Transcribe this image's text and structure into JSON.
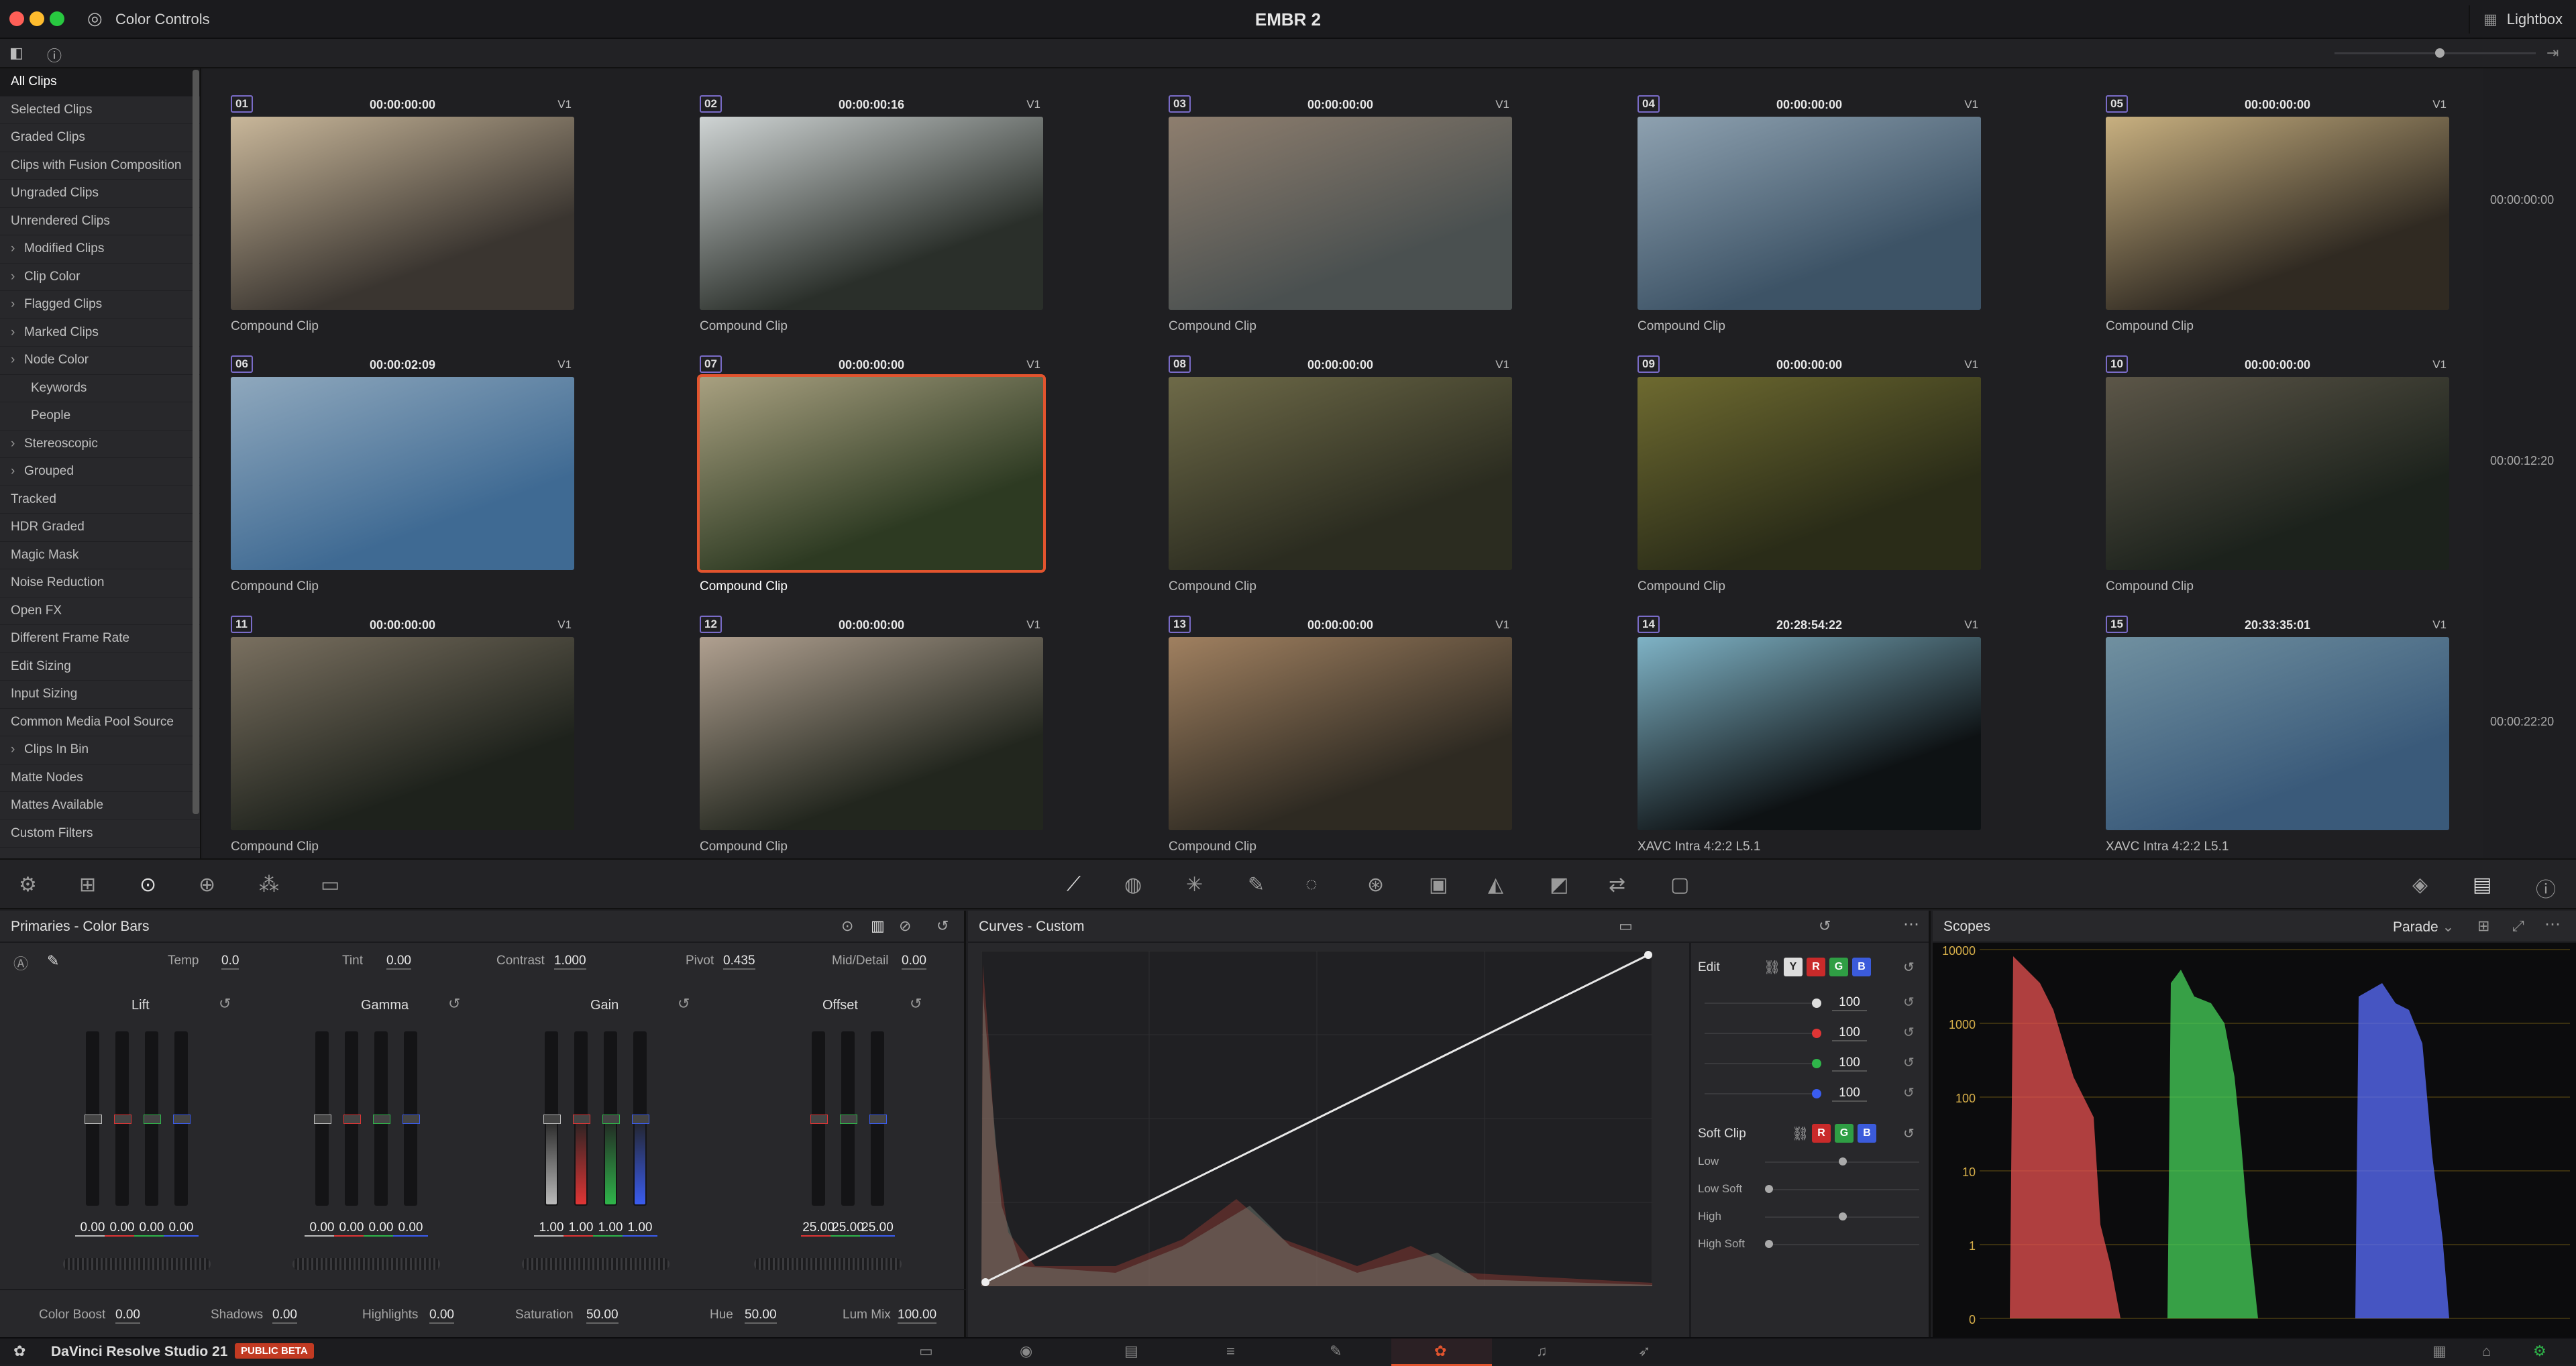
{
  "window": {
    "title": "EMBR 2",
    "panel_title": "Color Controls",
    "lightbox_label": "Lightbox"
  },
  "sidebar": {
    "items": [
      {
        "label": "All Clips",
        "selected": true,
        "expandable": false
      },
      {
        "label": "Selected Clips",
        "expandable": false
      },
      {
        "label": "Graded Clips",
        "expandable": false
      },
      {
        "label": "Clips with Fusion Composition",
        "expandable": false
      },
      {
        "label": "Ungraded Clips",
        "expandable": false
      },
      {
        "label": "Unrendered Clips",
        "expandable": false
      },
      {
        "label": "Modified Clips",
        "expandable": true
      },
      {
        "label": "Clip Color",
        "expandable": true
      },
      {
        "label": "Flagged Clips",
        "expandable": true
      },
      {
        "label": "Marked Clips",
        "expandable": true
      },
      {
        "label": "Node Color",
        "expandable": true
      },
      {
        "label": "Keywords",
        "child": true
      },
      {
        "label": "People",
        "child": true
      },
      {
        "label": "Stereoscopic",
        "expandable": true
      },
      {
        "label": "Grouped",
        "expandable": true
      },
      {
        "label": "Tracked",
        "expandable": false
      },
      {
        "label": "HDR Graded",
        "expandable": false
      },
      {
        "label": "Magic Mask",
        "expandable": false
      },
      {
        "label": "Noise Reduction",
        "expandable": false
      },
      {
        "label": "Open FX",
        "expandable": false
      },
      {
        "label": "Different Frame Rate",
        "expandable": false
      },
      {
        "label": "Edit Sizing",
        "expandable": false
      },
      {
        "label": "Input Sizing",
        "expandable": false
      },
      {
        "label": "Common Media Pool Source",
        "expandable": false
      },
      {
        "label": "Clips In Bin",
        "expandable": true
      },
      {
        "label": "Matte Nodes",
        "expandable": false
      },
      {
        "label": "Mattes Available",
        "expandable": false
      },
      {
        "label": "Custom Filters",
        "expandable": false
      }
    ]
  },
  "clips": [
    {
      "num": "01",
      "tc": "00:00:00:00",
      "track": "V1",
      "name": "Compound Clip",
      "c1": "#3a3530",
      "c2": "#c9b79a"
    },
    {
      "num": "02",
      "tc": "00:00:00:16",
      "track": "V1",
      "name": "Compound Clip",
      "c1": "#2a2f2a",
      "c2": "#cfd4d4"
    },
    {
      "num": "03",
      "tc": "00:00:00:00",
      "track": "V1",
      "name": "Compound Clip",
      "c1": "#4a5050",
      "c2": "#8e7e6e"
    },
    {
      "num": "04",
      "tc": "00:00:00:00",
      "track": "V1",
      "name": "Compound Clip",
      "c1": "#3d5366",
      "c2": "#8ea1b0"
    },
    {
      "num": "05",
      "tc": "00:00:00:00",
      "track": "V1",
      "name": "Compound Clip",
      "c1": "#302a22",
      "c2": "#c8b080"
    },
    {
      "num": "06",
      "tc": "00:00:02:09",
      "track": "V1",
      "name": "Compound Clip",
      "c1": "#3f6a93",
      "c2": "#8fa8bd"
    },
    {
      "num": "07",
      "tc": "00:00:00:00",
      "track": "V1",
      "name": "Compound Clip",
      "c1": "#2d3a22",
      "c2": "#a8a080",
      "selected": true
    },
    {
      "num": "08",
      "tc": "00:00:00:00",
      "track": "V1",
      "name": "Compound Clip",
      "c1": "#2b2c20",
      "c2": "#6e6a48"
    },
    {
      "num": "09",
      "tc": "00:00:00:00",
      "track": "V1",
      "name": "Compound Clip",
      "c1": "#2a2c18",
      "c2": "#6e6a30"
    },
    {
      "num": "10",
      "tc": "00:00:00:00",
      "track": "V1",
      "name": "Compound Clip",
      "c1": "#1c221c",
      "c2": "#5c5648"
    },
    {
      "num": "11",
      "tc": "00:00:00:00",
      "track": "V1",
      "name": "Compound Clip",
      "c1": "#1e221c",
      "c2": "#7a7060"
    },
    {
      "num": "12",
      "tc": "00:00:00:00",
      "track": "V1",
      "name": "Compound Clip",
      "c1": "#22261e",
      "c2": "#b0a090"
    },
    {
      "num": "13",
      "tc": "00:00:00:00",
      "track": "V1",
      "name": "Compound Clip",
      "c1": "#2e2a22",
      "c2": "#a08060"
    },
    {
      "num": "14",
      "tc": "20:28:54:22",
      "track": "V1",
      "name": "XAVC Intra 4:2:2 L5.1",
      "c1": "#0e1214",
      "c2": "#7fb3c6"
    },
    {
      "num": "15",
      "tc": "20:33:35:01",
      "track": "V1",
      "name": "XAVC Intra 4:2:2 L5.1",
      "c1": "#3a5a7a",
      "c2": "#7090a0"
    }
  ],
  "timeline_marks": [
    "00:00:00:00",
    "00:00:12:20",
    "00:00:22:20"
  ],
  "primaries": {
    "title": "Primaries - Color Bars",
    "top_params": [
      {
        "label": "Temp",
        "value": "0.0"
      },
      {
        "label": "Tint",
        "value": "0.00"
      },
      {
        "label": "Contrast",
        "value": "1.000"
      },
      {
        "label": "Pivot",
        "value": "0.435"
      },
      {
        "label": "Mid/Detail",
        "value": "0.00"
      }
    ],
    "wheels": [
      {
        "label": "Lift",
        "values": [
          "0.00",
          "0.00",
          "0.00",
          "0.00"
        ]
      },
      {
        "label": "Gamma",
        "values": [
          "0.00",
          "0.00",
          "0.00",
          "0.00"
        ]
      },
      {
        "label": "Gain",
        "values": [
          "1.00",
          "1.00",
          "1.00",
          "1.00"
        ]
      },
      {
        "label": "Offset",
        "values": [
          "25.00",
          "25.00",
          "25.00"
        ]
      }
    ],
    "bottom_params": [
      {
        "label": "Color Boost",
        "value": "0.00"
      },
      {
        "label": "Shadows",
        "value": "0.00"
      },
      {
        "label": "Highlights",
        "value": "0.00"
      },
      {
        "label": "Saturation",
        "value": "50.00"
      },
      {
        "label": "Hue",
        "value": "50.00"
      },
      {
        "label": "Lum Mix",
        "value": "100.00"
      }
    ]
  },
  "curves": {
    "title": "Curves - Custom",
    "edit_label": "Edit",
    "channels": [
      "Y",
      "R",
      "G",
      "B"
    ],
    "intensities": [
      "100",
      "100",
      "100",
      "100"
    ],
    "soft_clip_label": "Soft Clip",
    "soft_clip": [
      "Low",
      "Low Soft",
      "High",
      "High Soft"
    ]
  },
  "scopes": {
    "title": "Scopes",
    "mode": "Parade",
    "scale": [
      "10000",
      "1000",
      "100",
      "10",
      "1",
      "0"
    ]
  },
  "appbar": {
    "product": "DaVinci Resolve Studio 21",
    "badge": "PUBLIC BETA"
  },
  "colors": {
    "accent": "#e2542e",
    "red": "#e03535",
    "green": "#2fb54a",
    "blue": "#3a5cf0",
    "purple": "#7a6cc8"
  }
}
